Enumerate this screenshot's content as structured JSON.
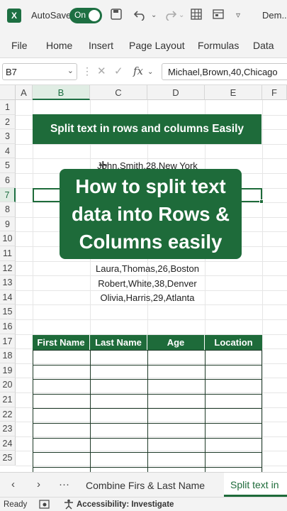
{
  "titlebar": {
    "autosave_label": "AutoSave",
    "toggle_state": "On",
    "doc_name": "Dem..."
  },
  "menu": [
    "File",
    "Home",
    "Insert",
    "Page Layout",
    "Formulas",
    "Data"
  ],
  "formula_bar": {
    "name_box": "B7",
    "formula_value": "Michael,Brown,40,Chicago"
  },
  "grid": {
    "columns": [
      "A",
      "B",
      "C",
      "D",
      "E",
      "F"
    ],
    "rows": [
      "1",
      "2",
      "3",
      "4",
      "5",
      "6",
      "7",
      "8",
      "9",
      "10",
      "11",
      "12",
      "13",
      "14",
      "15",
      "16",
      "17",
      "18",
      "19",
      "20",
      "21",
      "22",
      "23",
      "24",
      "25"
    ],
    "title": "Split text in rows and columns Easily",
    "data_rows": [
      "John,Smith,28,New York",
      "Laura,Thomas,26,Boston",
      "Robert,White,38,Denver",
      "Olivia,Harris,29,Atlanta"
    ],
    "table_headers": [
      "First Name",
      "Last Name",
      "Age",
      "Location"
    ]
  },
  "overlay": {
    "lines": [
      "How to split text",
      "data into Rows &",
      "Columns easily"
    ]
  },
  "sheet_tabs": {
    "tabs": [
      "Combine Firs & Last Name",
      "Split text in"
    ],
    "active": "Split text in"
  },
  "status": {
    "ready": "Ready",
    "accessibility": "Accessibility: Investigate"
  },
  "colors": {
    "accent": "#1e6b3a",
    "excel_green": "#1d6f42"
  }
}
